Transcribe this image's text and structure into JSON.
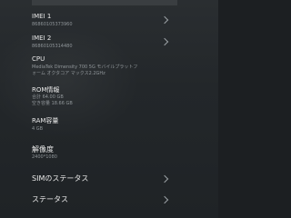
{
  "items": [
    {
      "title": "IMEI 1",
      "value": "86860105373960"
    },
    {
      "title": "IMEI 2",
      "value": "86860105314480"
    },
    {
      "title": "CPU",
      "value_line1": "MediaTek Dimensity 700 5G モバイルプラットフ",
      "value_line2": "ォーム オクタコア マックス2.2GHz"
    },
    {
      "title": "ROM情報",
      "value_line1": "合計 64.00 GB",
      "value_line2": "空き容量 18.66 GB"
    },
    {
      "title": "RAM容量",
      "value": "4 GB"
    },
    {
      "title": "解像度",
      "value": "2400*1080"
    },
    {
      "title": "SIMのステータス"
    },
    {
      "title": "ステータス"
    }
  ]
}
